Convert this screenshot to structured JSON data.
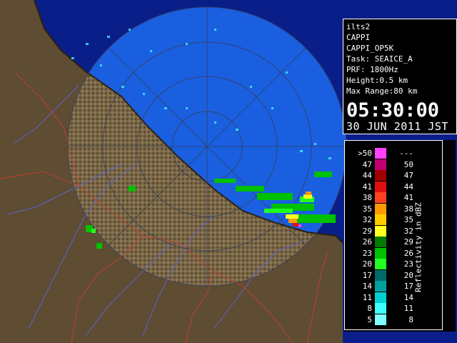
{
  "radar_info": {
    "station": "ilts2",
    "product": "CAPPI",
    "product_code": "CAPPI_OP5K",
    "task": "Task: SEAICE_A",
    "prf": "PRF: 1800Hz",
    "height": "Height:0.5 km",
    "max_range": "Max Range:80 km",
    "time": "05:30:00",
    "date": "30 JUN 2011 JST"
  },
  "legend": {
    "unit_label": "Reflectivity in dBZ",
    "rows": [
      {
        "low": ">50",
        "high": "---",
        "color": "#ff40ff"
      },
      {
        "low": "47",
        "high": "50",
        "color": "#c00070"
      },
      {
        "low": "44",
        "high": "47",
        "color": "#a00000"
      },
      {
        "low": "41",
        "high": "44",
        "color": "#e01010"
      },
      {
        "low": "38",
        "high": "41",
        "color": "#ff4020"
      },
      {
        "low": "35",
        "high": "38",
        "color": "#ff9a00"
      },
      {
        "low": "32",
        "high": "35",
        "color": "#ffcc00"
      },
      {
        "low": "29",
        "high": "32",
        "color": "#ffff20"
      },
      {
        "low": "26",
        "high": "29",
        "color": "#007a00"
      },
      {
        "low": "23",
        "high": "26",
        "color": "#00c000"
      },
      {
        "low": "20",
        "high": "23",
        "color": "#20ff20"
      },
      {
        "low": "17",
        "high": "20",
        "color": "#006a6a"
      },
      {
        "low": "14",
        "high": "17",
        "color": "#00a0a0"
      },
      {
        "low": "11",
        "high": "14",
        "color": "#00d0d0"
      },
      {
        "low": "8",
        "high": "11",
        "color": "#40ffff"
      },
      {
        "low": "5",
        "high": "8",
        "color": "#80ffff"
      }
    ]
  },
  "colors": {
    "sea_coverage": "#1a5fe0",
    "outside_coverage": "#0a1e8a",
    "land": "#7a6848",
    "land_dark": "#4e3f2a",
    "rivers": "#5a66d0",
    "boundaries": "#c04030",
    "range_rings": "#34405a"
  }
}
